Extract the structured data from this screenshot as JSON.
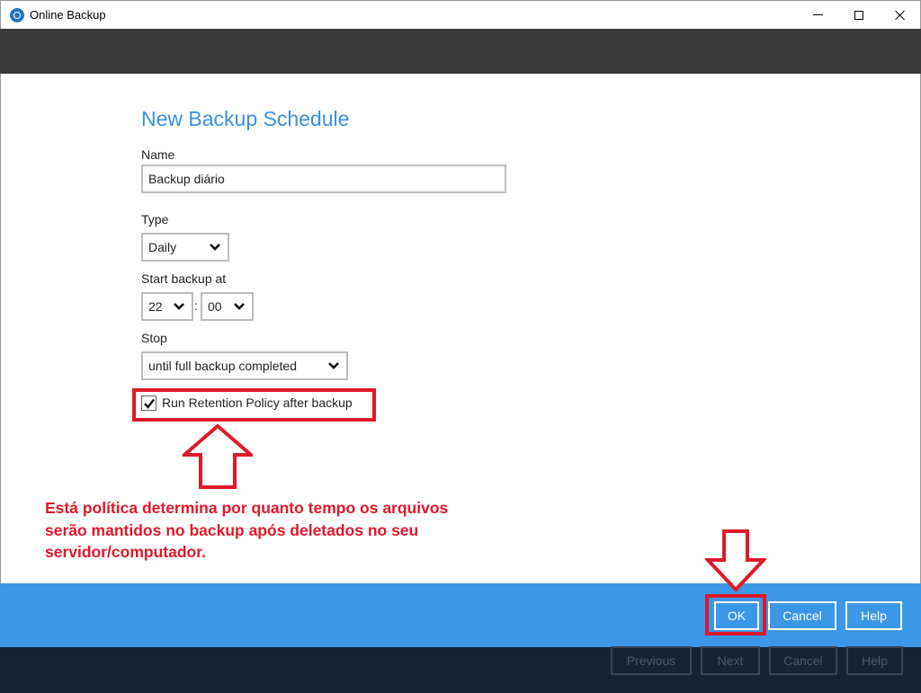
{
  "window": {
    "title": "Online Backup",
    "icon": "app-logo-icon"
  },
  "form": {
    "page_title": "New Backup Schedule",
    "name_label": "Name",
    "name_value": "Backup diário",
    "type_label": "Type",
    "type_value": "Daily",
    "start_label": "Start backup at",
    "start_hour": "22",
    "start_minute": "00",
    "time_separator": ":",
    "stop_label": "Stop",
    "stop_value": "until full backup completed",
    "retention_label": "Run Retention Policy after backup",
    "retention_checked": true
  },
  "annotation": {
    "text": "Está política determina por quanto tempo os arquivos serão mantidos no backup após deletados no seu servidor/computador.",
    "color": "#e0182b"
  },
  "dialog_buttons": {
    "ok": "OK",
    "cancel": "Cancel",
    "help": "Help"
  },
  "wizard_buttons": {
    "previous": "Previous",
    "next": "Next",
    "cancel": "Cancel",
    "help": "Help"
  },
  "colors": {
    "title_blue": "#3b8fdf",
    "footer_blue": "#3c97e8",
    "header_dark": "#3a3a3a",
    "footer_dark": "#162236",
    "annotation_red": "#e0182b"
  }
}
